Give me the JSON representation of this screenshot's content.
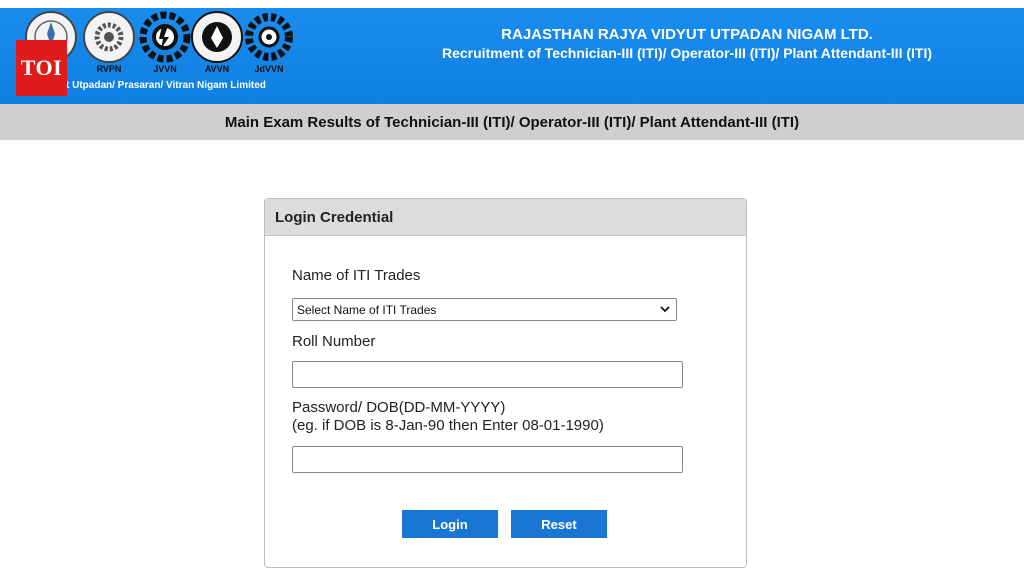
{
  "header": {
    "org_name": "RAJASTHAN RAJYA VIDYUT UTPADAN NIGAM LTD.",
    "recruitment": "Recruitment of Technician-III (ITI)/ Operator-III (ITI)/ Plant Attendant-III (ITI)",
    "logos": [
      "RVPN",
      "JVVN",
      "AVVN",
      "JdVVN"
    ],
    "logos_caption": "t Utpadan/ Prasaran/ Vitran Nigam Limited",
    "colors": {
      "header_bg": "#1a8ef0",
      "result_bar_bg": "#cfcfcf"
    }
  },
  "watermark": {
    "label": "TOI",
    "color": "#e01b1b"
  },
  "result_bar": {
    "title": "Main Exam Results of Technician-III (ITI)/ Operator-III (ITI)/ Plant Attendant-III (ITI)"
  },
  "login": {
    "panel_title": "Login Credential",
    "trade_label": "Name of ITI Trades",
    "trade_select_value": "Select Name of ITI Trades",
    "roll_label": "Roll Number",
    "roll_value": "",
    "password_label": "Password/ DOB(DD-MM-YYYY)",
    "password_hint": "(eg. if DOB is 8-Jan-90 then Enter 08-01-1990)",
    "password_value": "",
    "login_button": "Login",
    "reset_button": "Reset",
    "button_color": "#1976d2"
  }
}
